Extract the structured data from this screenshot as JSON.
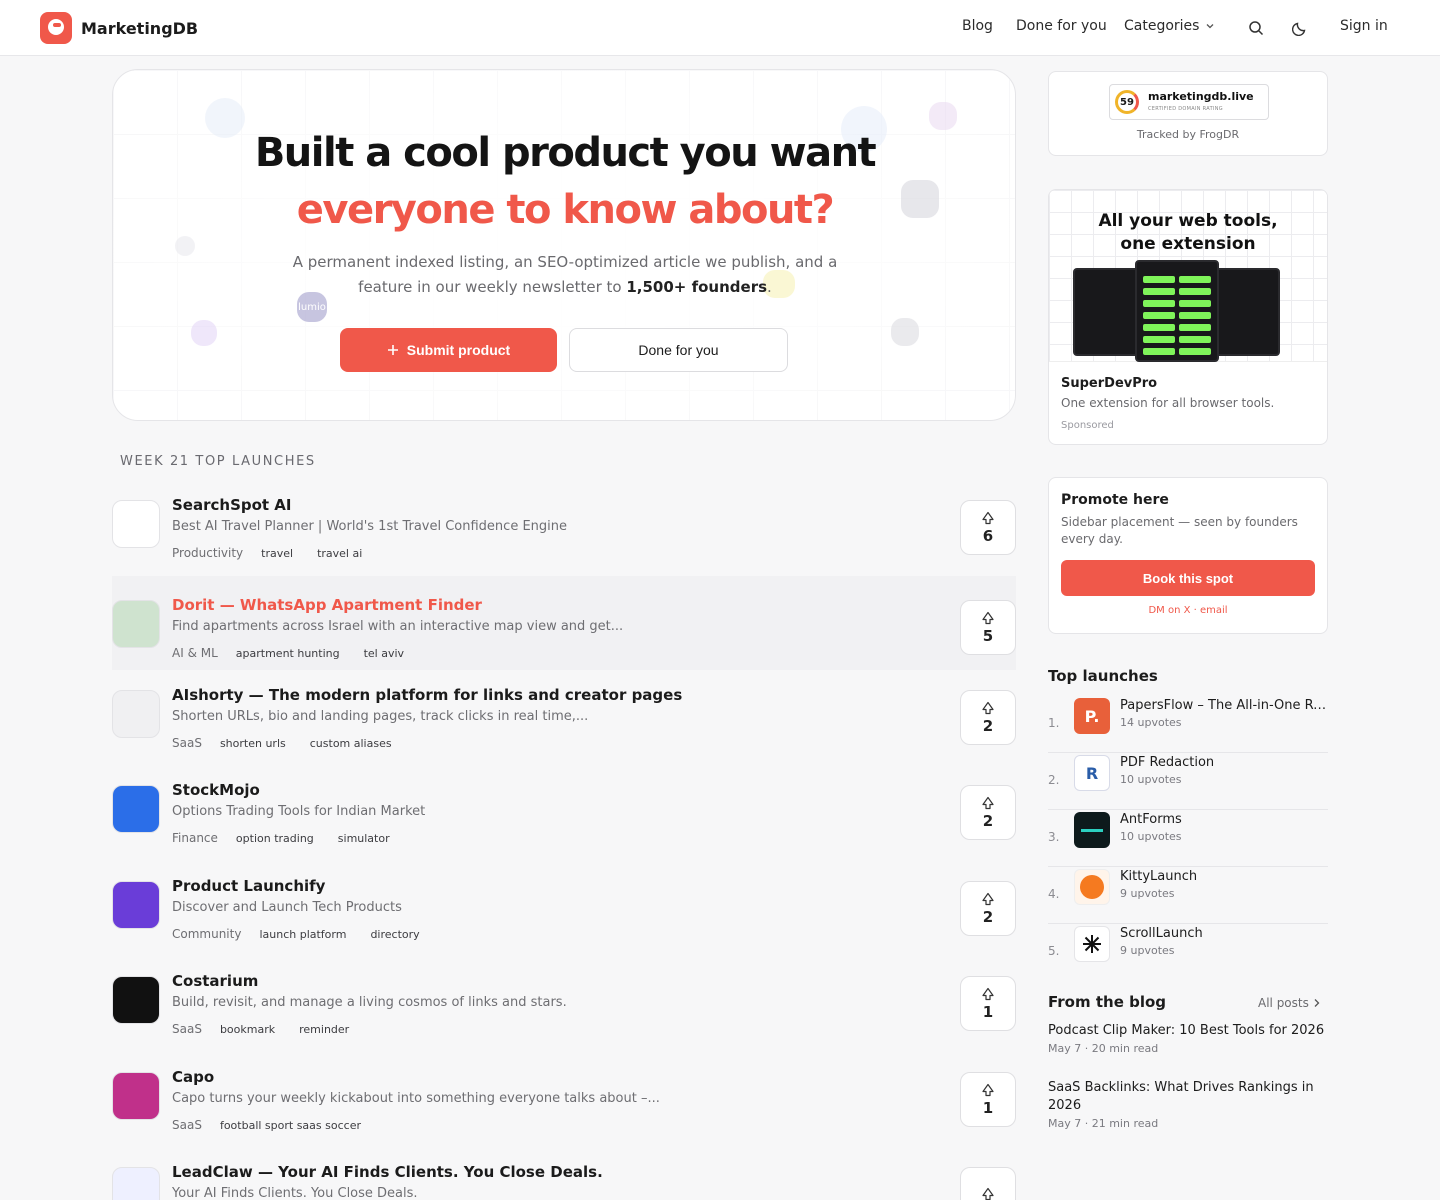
{
  "brand": {
    "name": "MarketingDB"
  },
  "nav": {
    "blog": "Blog",
    "dfy": "Done for you",
    "categories": "Categories",
    "signin": "Sign in"
  },
  "hero": {
    "title_line1": "Built a cool product you want",
    "title_line2": "everyone to know about?",
    "sub_part1": "A permanent indexed listing, an SEO-optimized article we publish, and a feature in our weekly newsletter to ",
    "sub_bold": "1,500+ founders",
    "sub_end": ".",
    "deco_word": "lumio",
    "submit_label": "Submit product",
    "dfy_label": "Done for you"
  },
  "launches": {
    "heading": "WEEK 21 TOP LAUNCHES",
    "items": [
      {
        "name": "SearchSpot AI",
        "desc": "Best AI Travel Planner | World's 1st Travel Confidence Engine",
        "category": "Productivity",
        "tags": [
          "travel",
          "travel ai"
        ],
        "votes": "6"
      },
      {
        "name": "Dorit — WhatsApp Apartment Finder",
        "desc": "Find apartments across Israel with an interactive map view and get...",
        "category": "AI & ML",
        "tags": [
          "apartment hunting",
          "tel aviv"
        ],
        "votes": "5"
      },
      {
        "name": "AIshorty — The modern platform for links and creator pages",
        "desc": "Shorten URLs, bio and landing pages, track clicks in real time,...",
        "category": "SaaS",
        "tags": [
          "shorten urls",
          "custom aliases"
        ],
        "votes": "2"
      },
      {
        "name": "StockMojo",
        "desc": "Options Trading Tools for Indian Market",
        "category": "Finance",
        "tags": [
          "option trading",
          "simulator"
        ],
        "votes": "2"
      },
      {
        "name": "Product Launchify",
        "desc": "Discover and Launch Tech Products",
        "category": "Community",
        "tags": [
          "launch platform",
          "directory"
        ],
        "votes": "2"
      },
      {
        "name": "Costarium",
        "desc": "Build, revisit, and manage a living cosmos of links and stars.",
        "category": "SaaS",
        "tags": [
          "bookmark",
          "reminder"
        ],
        "votes": "1"
      },
      {
        "name": "Capo",
        "desc": "Capo turns your weekly kickabout into something everyone talks about –...",
        "category": "SaaS",
        "tags": [
          "football sport saas soccer"
        ],
        "votes": "1"
      },
      {
        "name": "LeadClaw — Your AI Finds Clients. You Close Deals.",
        "desc": "Your AI Finds Clients. You Close Deals.",
        "category": "",
        "tags": [],
        "votes": ""
      }
    ]
  },
  "sidebar": {
    "badge": {
      "score": "59",
      "domain": "marketingdb.live",
      "sub": "CERTIFIED DOMAIN RATING",
      "tracked": "Tracked by FrogDR"
    },
    "ad": {
      "head1": "All your web tools,",
      "head2": "one extension",
      "title": "SuperDevPro",
      "desc": "One extension for all browser tools.",
      "sponsored": "Sponsored"
    },
    "promo": {
      "title": "Promote here",
      "desc": "Sidebar placement — seen by founders every day.",
      "button": "Book this spot",
      "dm": "DM on X · email"
    },
    "top": {
      "heading": "Top launches",
      "items": [
        {
          "rank": "1.",
          "name": "PapersFlow – The All-in-One Research Platform",
          "votes": "14 upvotes",
          "mark": "P."
        },
        {
          "rank": "2.",
          "name": "PDF Redaction",
          "votes": "10 upvotes",
          "mark": "R"
        },
        {
          "rank": "3.",
          "name": "AntForms",
          "votes": "10 upvotes",
          "mark": ""
        },
        {
          "rank": "4.",
          "name": "KittyLaunch",
          "votes": "9 upvotes",
          "mark": ""
        },
        {
          "rank": "5.",
          "name": "ScrollLaunch",
          "votes": "9 upvotes",
          "mark": ""
        }
      ]
    },
    "blog": {
      "heading": "From the blog",
      "all_posts": "All posts",
      "posts": [
        {
          "title": "Podcast Clip Maker: 10 Best Tools for 2026",
          "meta": "May 7 · 20 min read"
        },
        {
          "title": "SaaS Backlinks: What Drives Rankings in 2026",
          "meta": "May 7 · 21 min read"
        }
      ]
    }
  },
  "colors": {
    "accent": "#f0584a",
    "text": "#1a1a1a",
    "muted": "#6a6a6e",
    "border": "#e5e5e8"
  }
}
